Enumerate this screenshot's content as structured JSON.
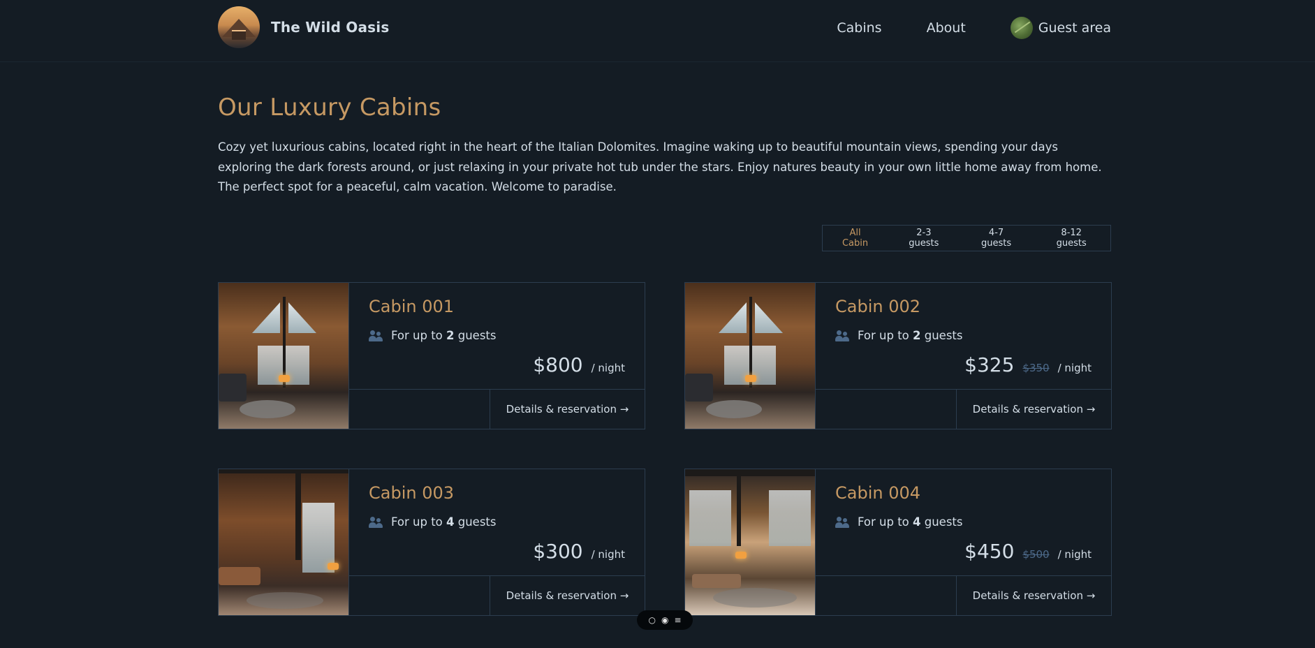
{
  "header": {
    "logo_text": "The Wild Oasis",
    "nav": [
      {
        "label": "Cabins"
      },
      {
        "label": "About"
      }
    ],
    "guest_area_label": "Guest area"
  },
  "page": {
    "title": "Our Luxury Cabins",
    "intro": "Cozy yet luxurious cabins, located right in the heart of the Italian Dolomites. Imagine waking up to beautiful mountain views, spending your days exploring the dark forests around, or just relaxing in your private hot tub under the stars. Enjoy natures beauty in your own little home away from home. The perfect spot for a peaceful, calm vacation. Welcome to paradise."
  },
  "filter": {
    "options": [
      "All Cabin",
      "2-3 guests",
      "4-7 guests",
      "8-12 guests"
    ],
    "active": "All Cabin"
  },
  "cabins": [
    {
      "name": "Cabin 001",
      "guests_prefix": "For up to ",
      "guests": "2",
      "guests_suffix": " guests",
      "price": "$800",
      "old_price": "",
      "per_night": "/ night",
      "link": "Details & reservation →"
    },
    {
      "name": "Cabin 002",
      "guests_prefix": "For up to ",
      "guests": "2",
      "guests_suffix": " guests",
      "price": "$325",
      "old_price": "$350",
      "per_night": "/ night",
      "link": "Details & reservation →"
    },
    {
      "name": "Cabin 003",
      "guests_prefix": "For up to ",
      "guests": "4",
      "guests_suffix": " guests",
      "price": "$300",
      "old_price": "",
      "per_night": "/ night",
      "link": "Details & reservation →"
    },
    {
      "name": "Cabin 004",
      "guests_prefix": "For up to ",
      "guests": "4",
      "guests_suffix": " guests",
      "price": "$450",
      "old_price": "$500",
      "per_night": "/ night",
      "link": "Details & reservation →"
    }
  ],
  "colors": {
    "background": "#141c24",
    "accent": "#c69963",
    "border": "#2c3d4f",
    "text": "#d4dee7",
    "muted": "#4d6a8a"
  },
  "toolbar": {
    "icons": [
      "comment-icon",
      "eye-icon",
      "sliders-icon"
    ]
  }
}
